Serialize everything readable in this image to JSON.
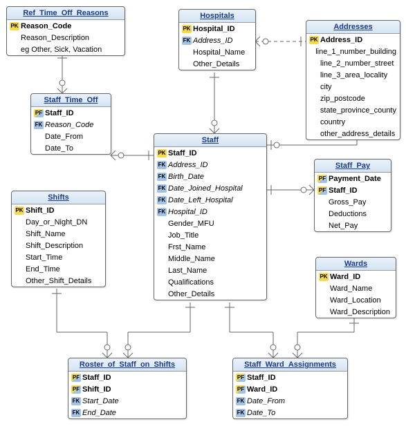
{
  "entities": {
    "ref_time_off_reasons": {
      "title": "Ref_Time_Off_Reasons",
      "rows": [
        {
          "key": "PK",
          "text": "Reason_Code",
          "style": "bold"
        },
        {
          "key": "",
          "text": "Reason_Description",
          "style": ""
        },
        {
          "key": "",
          "text": "eg Other, Sick, Vacation",
          "style": ""
        }
      ]
    },
    "hospitals": {
      "title": "Hospitals",
      "rows": [
        {
          "key": "PK",
          "text": "Hospital_ID",
          "style": "bold"
        },
        {
          "key": "FK",
          "text": "Address_ID",
          "style": "italic"
        },
        {
          "key": "",
          "text": "Hospital_Name",
          "style": ""
        },
        {
          "key": "",
          "text": "Other_Details",
          "style": ""
        }
      ]
    },
    "addresses": {
      "title": "Addresses",
      "rows": [
        {
          "key": "PK",
          "text": "Address_ID",
          "style": "bold"
        },
        {
          "key": "",
          "text": "line_1_number_building",
          "style": ""
        },
        {
          "key": "",
          "text": "line_2_number_street",
          "style": ""
        },
        {
          "key": "",
          "text": "line_3_area_locality",
          "style": ""
        },
        {
          "key": "",
          "text": "city",
          "style": ""
        },
        {
          "key": "",
          "text": "zip_postcode",
          "style": ""
        },
        {
          "key": "",
          "text": "state_province_county",
          "style": ""
        },
        {
          "key": "",
          "text": "country",
          "style": ""
        },
        {
          "key": "",
          "text": "other_address_details",
          "style": ""
        }
      ]
    },
    "staff_time_off": {
      "title": "Staff_Time_Off",
      "rows": [
        {
          "key": "PF",
          "text": "Staff_ID",
          "style": "bold"
        },
        {
          "key": "FK",
          "text": "Reason_Code",
          "style": "italic"
        },
        {
          "key": "",
          "text": "Date_From",
          "style": ""
        },
        {
          "key": "",
          "text": "Date_To",
          "style": ""
        }
      ]
    },
    "staff": {
      "title": "Staff",
      "rows": [
        {
          "key": "PK",
          "text": "Staff_ID",
          "style": "bold"
        },
        {
          "key": "FK",
          "text": "Address_ID",
          "style": "italic"
        },
        {
          "key": "FK",
          "text": "Birth_Date",
          "style": "italic"
        },
        {
          "key": "FK",
          "text": "Date_Joined_Hospital",
          "style": "italic"
        },
        {
          "key": "FK",
          "text": "Date_Left_Hospital",
          "style": "italic"
        },
        {
          "key": "FK",
          "text": "Hospital_ID",
          "style": "italic"
        },
        {
          "key": "",
          "text": "Gender_MFU",
          "style": ""
        },
        {
          "key": "",
          "text": "Job_Title",
          "style": ""
        },
        {
          "key": "",
          "text": "Frst_Name",
          "style": ""
        },
        {
          "key": "",
          "text": "Middle_Name",
          "style": ""
        },
        {
          "key": "",
          "text": "Last_Name",
          "style": ""
        },
        {
          "key": "",
          "text": "Qualifications",
          "style": ""
        },
        {
          "key": "",
          "text": "Other_Details",
          "style": ""
        }
      ]
    },
    "staff_pay": {
      "title": "Staff_Pay",
      "rows": [
        {
          "key": "PF",
          "text": "Payment_Date",
          "style": "bold"
        },
        {
          "key": "PF",
          "text": "Staff_ID",
          "style": "bold"
        },
        {
          "key": "",
          "text": "Gross_Pay",
          "style": ""
        },
        {
          "key": "",
          "text": "Deductions",
          "style": ""
        },
        {
          "key": "",
          "text": "Net_Pay",
          "style": ""
        }
      ]
    },
    "shifts": {
      "title": "Shifts",
      "rows": [
        {
          "key": "PK",
          "text": "Shift_ID",
          "style": "bold"
        },
        {
          "key": "",
          "text": "Day_or_Night_DN",
          "style": ""
        },
        {
          "key": "",
          "text": "Shift_Name",
          "style": ""
        },
        {
          "key": "",
          "text": "Shift_Description",
          "style": ""
        },
        {
          "key": "",
          "text": "Start_Time",
          "style": ""
        },
        {
          "key": "",
          "text": "End_Time",
          "style": ""
        },
        {
          "key": "",
          "text": "Other_Shift_Details",
          "style": ""
        }
      ]
    },
    "wards": {
      "title": "Wards",
      "rows": [
        {
          "key": "PK",
          "text": "Ward_ID",
          "style": "bold"
        },
        {
          "key": "",
          "text": "Ward_Name",
          "style": ""
        },
        {
          "key": "",
          "text": "Ward_Location",
          "style": ""
        },
        {
          "key": "",
          "text": "Ward_Description",
          "style": ""
        }
      ]
    },
    "roster": {
      "title": "Roster_of_Staff_on_Shifts",
      "rows": [
        {
          "key": "PF",
          "text": "Staff_ID",
          "style": "bold"
        },
        {
          "key": "PF",
          "text": "Shift_ID",
          "style": "bold"
        },
        {
          "key": "FK",
          "text": "Start_Date",
          "style": "italic"
        },
        {
          "key": "FK",
          "text": "End_Date",
          "style": "italic"
        }
      ]
    },
    "staff_ward": {
      "title": "Staff_Ward_Assignments",
      "rows": [
        {
          "key": "PF",
          "text": "Staff_ID",
          "style": "bold"
        },
        {
          "key": "PF",
          "text": "Ward_ID",
          "style": "bold"
        },
        {
          "key": "FK",
          "text": "Date_From",
          "style": "italic"
        },
        {
          "key": "FK",
          "text": "Date_To",
          "style": "italic"
        }
      ]
    }
  }
}
